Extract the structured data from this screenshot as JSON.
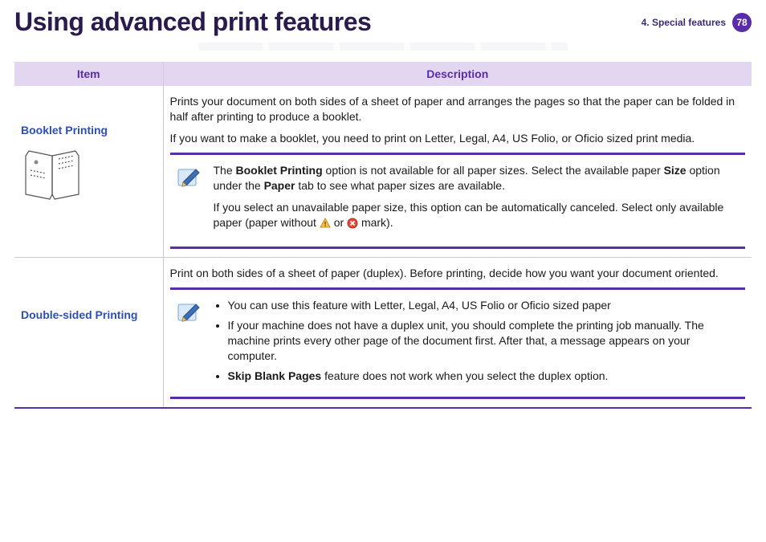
{
  "header": {
    "title": "Using advanced print features",
    "section": "4.  Special features",
    "page": "78"
  },
  "table": {
    "head": {
      "item": "Item",
      "desc": "Description"
    },
    "rows": [
      {
        "item": "Booklet Printing",
        "p1": "Prints your document on both sides of a sheet of paper and arranges the pages so that the paper can be folded in half after printing to produce a booklet.",
        "p2": "If you want to make a booklet, you need to print on Letter, Legal, A4, US Folio, or Oficio sized print media.",
        "note": {
          "line1_a": "The ",
          "line1_bold1": "Booklet Printing",
          "line1_b": " option is not available for all paper sizes. Select the available paper ",
          "line1_bold2": "Size",
          "line1_c": " option under the ",
          "line1_bold3": "Paper",
          "line1_d": " tab to see what paper sizes are available.",
          "line2_a": "If you select an unavailable paper size, this option can be automatically canceled. Select only available paper (paper without ",
          "line2_b": " or ",
          "line2_c": " mark)."
        }
      },
      {
        "item": "Double-sided Printing",
        "p1": "Print on both sides of a sheet of paper (duplex). Before printing, decide how you want your document oriented.",
        "note": {
          "li1": "You can use this feature with Letter, Legal, A4, US Folio or Oficio sized paper",
          "li2": "If your machine does not have a duplex unit, you should complete the printing job manually. The machine prints every other page of the document first. After that, a message appears on your computer.",
          "li3_bold": "Skip Blank Pages",
          "li3_rest": " feature does not work when you select the duplex option."
        }
      }
    ]
  }
}
